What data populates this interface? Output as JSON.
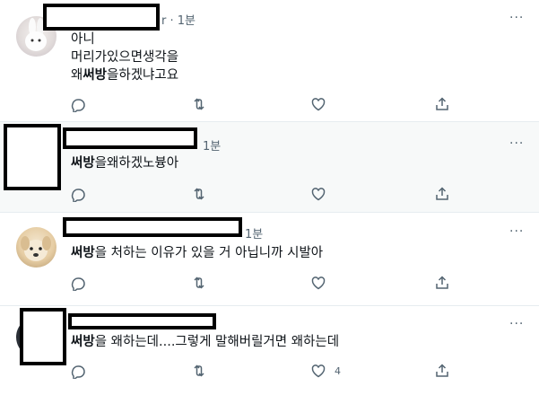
{
  "tweets": [
    {
      "time": "r · 1분",
      "lines": [
        "아니",
        "머리가있으면생각을",
        "왜|써방|을하겠냐고요"
      ],
      "like_count": ""
    },
    {
      "time": "1분",
      "lines": [
        "|써방|을왜하겠노븅아"
      ],
      "like_count": ""
    },
    {
      "time": "1분",
      "lines": [
        "|써방|을 처하는 이유가 있을 거 아닙니까 시발아"
      ],
      "like_count": ""
    },
    {
      "time": "",
      "lines": [
        "|써방|을 왜하는데....그렇게 말해버릴거면 왜하는데"
      ],
      "like_count": "4"
    }
  ],
  "bold_word": "써방",
  "more_label": "···",
  "colors": {
    "icon": "#536471",
    "separator": "#e6ecf0",
    "highlight_bg": "#f7f9f9"
  },
  "icons": [
    "reply-icon",
    "retweet-icon",
    "like-icon",
    "share-icon"
  ]
}
